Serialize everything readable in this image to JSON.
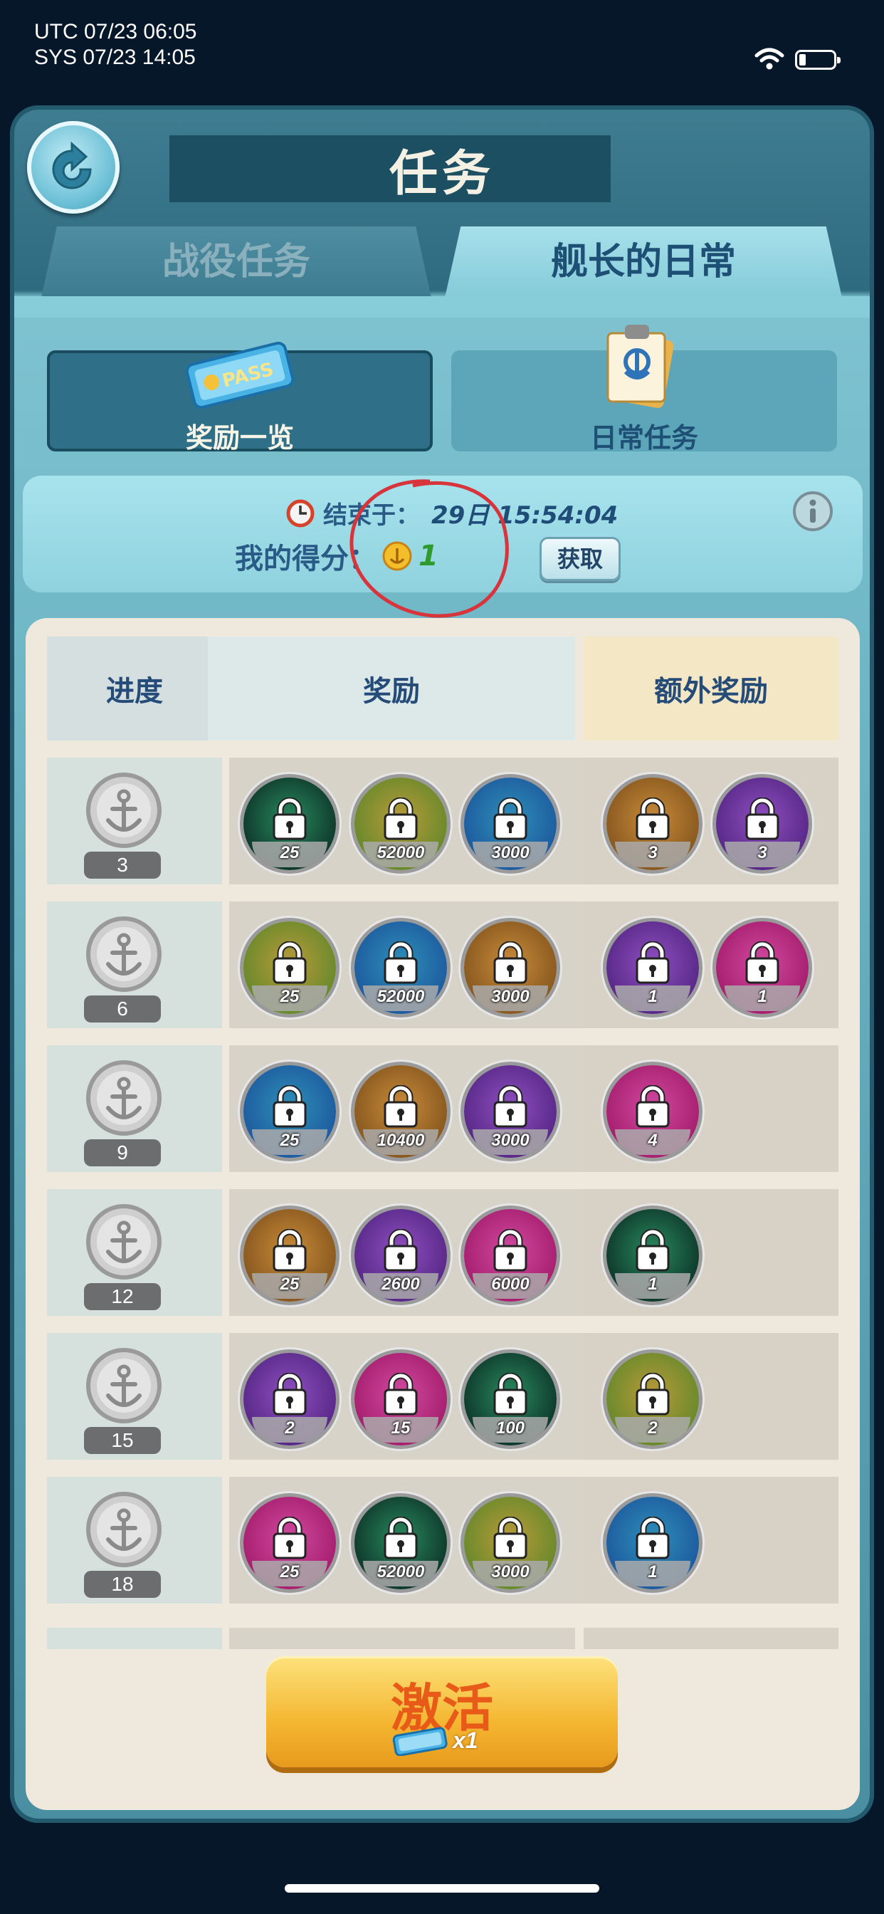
{
  "status_bar": {
    "utc": "UTC 07/23 06:05",
    "sys": "SYS 07/23 14:05"
  },
  "header": {
    "title": "任务"
  },
  "tabs": {
    "campaign": "战役任务",
    "daily": "舰长的日常"
  },
  "subtabs": {
    "rewards_overview": "奖励一览",
    "daily_tasks": "日常任务",
    "pass_icon_text": "PASS"
  },
  "info": {
    "ends_label": "结束于：",
    "ends_value": "29日 15:54:04",
    "score_label": "我的得分：",
    "score_value": "1",
    "get_button": "获取"
  },
  "table": {
    "headers": {
      "progress": "进度",
      "rewards": "奖励",
      "extra": "额外奖励"
    },
    "rows": [
      {
        "level": "3",
        "rewards": [
          "25",
          "52000",
          "3000"
        ],
        "extra": [
          "3",
          "3"
        ]
      },
      {
        "level": "6",
        "rewards": [
          "25",
          "52000",
          "3000"
        ],
        "extra": [
          "1",
          "1"
        ]
      },
      {
        "level": "9",
        "rewards": [
          "25",
          "10400",
          "3000"
        ],
        "extra": [
          "4"
        ]
      },
      {
        "level": "12",
        "rewards": [
          "25",
          "2600",
          "6000"
        ],
        "extra": [
          "1"
        ]
      },
      {
        "level": "15",
        "rewards": [
          "2",
          "15",
          "100"
        ],
        "extra": [
          "2"
        ]
      },
      {
        "level": "18",
        "rewards": [
          "25",
          "52000",
          "3000"
        ],
        "extra": [
          "1"
        ]
      }
    ]
  },
  "activate": {
    "label": "激活",
    "qty": "x1"
  },
  "colors": {
    "accent_red": "#d8343c",
    "score_green": "#2f9a2e",
    "button_orange": "#e85a18"
  }
}
